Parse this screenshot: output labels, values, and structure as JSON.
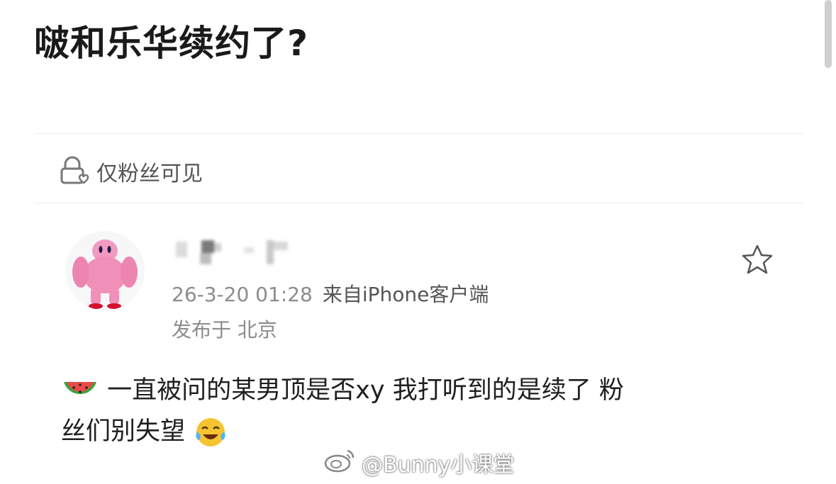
{
  "post": {
    "headline": "啵和乐华续约了?",
    "visibility": "仅粉丝可见",
    "username": "▘▚ ▝ ▘",
    "time": "26-3-20 01:28",
    "source": "来自iPhone客户端",
    "location": "发布于 北京",
    "body_line1": "一直被问的某男顶是否xy 我打听到的是续了 粉",
    "body_line2": "丝们别失望"
  },
  "icons": {
    "visibility": "lock-heart-icon",
    "favorite": "star-icon",
    "lead_emoji": "watermelon-emoji",
    "trail_emoji": "laughing-crying-emoji",
    "watermark": "weibo-logo-icon"
  },
  "watermark": {
    "text": "@Bunny小课堂"
  }
}
